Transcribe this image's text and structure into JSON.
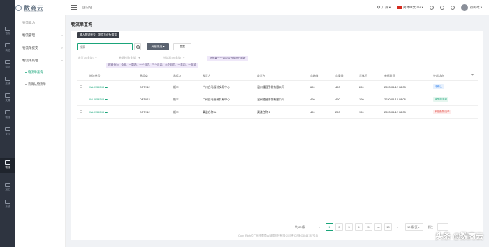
{
  "header": {
    "logo_text": "数商云",
    "logo_sub": "SHUSHANGYUN.COM",
    "breadcrumb": "国内站",
    "location": "广州",
    "language": "简体中文-ZH",
    "user_name": "御美政"
  },
  "rail": {
    "items": [
      {
        "label": "首页"
      },
      {
        "label": "商品"
      },
      {
        "label": "会员"
      },
      {
        "label": "店铺"
      },
      {
        "label": "交易"
      },
      {
        "label": "物流"
      },
      {
        "label": "支付"
      },
      {
        "label": "物流"
      },
      {
        "label": "加工"
      },
      {
        "label": "系统"
      }
    ]
  },
  "subnav": {
    "title": "物流能力",
    "items": [
      {
        "label": "物流管理"
      },
      {
        "label": "物流单提交"
      },
      {
        "label": "物流单处理"
      }
    ],
    "children": [
      {
        "label": "物流单查询"
      },
      {
        "label": "待确认物流单"
      }
    ]
  },
  "main": {
    "page_title": "物流单查询",
    "tooltip_search": "输入物流单号、发货方进行搜索",
    "search_placeholder": "搜索",
    "advanced_filter": "高级筛选 ▾",
    "reset": "重置",
    "filters": [
      "收货方(全部)",
      "单据时间(全部)",
      "外部状态(全部)"
    ],
    "tip_time": "时间分为：今天、一周内、一个月内、三个月内、六个月内、一年内、一年前",
    "tip_options": "选择每一个选项后列表进行刷新"
  },
  "table": {
    "columns": [
      "物流单号",
      "承运商",
      "承运方",
      "发货方",
      "收货方",
      "总箱数",
      "总重量",
      "货体积",
      "单据时间",
      "外部状态"
    ],
    "rows": [
      {
        "order": "WL0954548",
        "carrier": "DPTY12",
        "mode": "顺丰",
        "sender": "广州白马服装交易中心",
        "receiver": "温州隆昌手袋有限公司",
        "boxes": "600",
        "weight": "400",
        "volume": "200",
        "time": "2020-05-12 08:08",
        "status": "待确认",
        "status_color": "#2f80ed",
        "status_bg": "#e8f1fd"
      },
      {
        "order": "WL0954548",
        "carrier": "DPTY12",
        "mode": "顺丰",
        "sender": "广州白马服装交易中心",
        "receiver": "温州隆昌手袋有限公司",
        "boxes": "400",
        "weight": "400",
        "volume": "100",
        "time": "2020-05-12 08:08",
        "status": "接受物流单",
        "status_color": "#1aa57a",
        "status_bg": "#e6f6ef"
      },
      {
        "order": "WL0954548",
        "carrier": "DPTY12",
        "mode": "顺丰",
        "sender": "渠道名称 A",
        "receiver": "渠道名称 B",
        "boxes": "400",
        "weight": "200",
        "volume": "100",
        "time": "2020-05-12 08:08",
        "status": "不接受物流单",
        "status_color": "#e5534b",
        "status_bg": "#fdecec"
      }
    ]
  },
  "pager": {
    "total": "共 80 条",
    "prev": "‹",
    "pages": [
      "1",
      "2",
      "3",
      "4",
      "5",
      "•••",
      "10"
    ],
    "next": "›",
    "size": "10 条/页 ▾",
    "goto": "前往"
  },
  "footer": {
    "copyright": "Copy Right©广州市数商云网络科技有限公司 粤ICP备13044787号-5"
  },
  "credit": "头条 @数商云"
}
